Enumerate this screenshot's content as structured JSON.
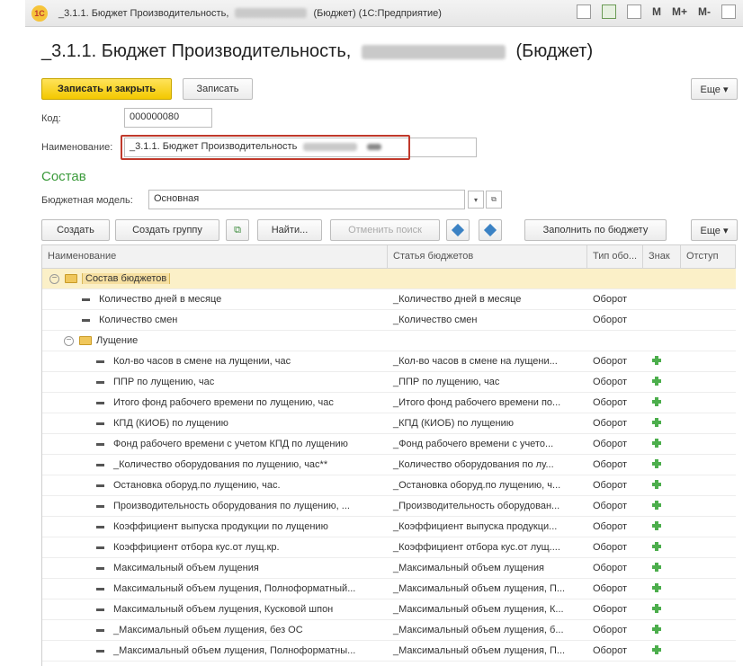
{
  "window": {
    "title": "_3.1.1. Бюджет Производительность,",
    "title_suffix": "(Бюджет) (1С:Предприятие)",
    "buttons": {
      "m": "M",
      "mplus": "M+",
      "mminus": "M-"
    }
  },
  "form": {
    "title": "_3.1.1. Бюджет Производительность,",
    "title_suffix": "(Бюджет)",
    "save_close": "Записать и закрыть",
    "save": "Записать",
    "more": "Еще ▾",
    "code_label": "Код:",
    "code_value": "000000080",
    "name_label": "Наименование:",
    "name_value": "_3.1.1. Бюджет Производительность"
  },
  "composition": {
    "title": "Состав",
    "model_label": "Бюджетная модель:",
    "model_value": "Основная",
    "toolbar": {
      "create": "Создать",
      "create_group": "Создать группу",
      "find": "Найти...",
      "cancel_search": "Отменить поиск",
      "fill_by_budget": "Заполнить по бюджету",
      "more": "Еще ▾"
    },
    "columns": [
      "Наименование",
      "Статья бюджетов",
      "Тип обо...",
      "Знак",
      "Отступ"
    ],
    "rows": [
      {
        "level": 0,
        "kind": "group",
        "name": "Состав бюджетов",
        "article": "",
        "type": "",
        "sign": false,
        "selected": true
      },
      {
        "level": 1,
        "kind": "item",
        "name": "Количество дней в месяце",
        "article": "_Количество дней в месяце",
        "type": "Оборот",
        "sign": false
      },
      {
        "level": 1,
        "kind": "item",
        "name": "Количество смен",
        "article": "_Количество смен",
        "type": "Оборот",
        "sign": false
      },
      {
        "level": 1,
        "kind": "group",
        "name": "Лущение",
        "article": "",
        "type": "",
        "sign": false
      },
      {
        "level": 2,
        "kind": "item",
        "name": "Кол-во часов в смене на лущении, час",
        "article": "_Кол-во часов в смене на лущени...",
        "type": "Оборот",
        "sign": true
      },
      {
        "level": 2,
        "kind": "item",
        "name": "ППР по лущению, час",
        "article": "_ППР по лущению, час",
        "type": "Оборот",
        "sign": true
      },
      {
        "level": 2,
        "kind": "item",
        "name": "Итого фонд рабочего времени по лущению, час",
        "article": "_Итого фонд рабочего времени по...",
        "type": "Оборот",
        "sign": true
      },
      {
        "level": 2,
        "kind": "item",
        "name": "КПД (КИОБ) по лущению",
        "article": "_КПД (КИОБ) по лущению",
        "type": "Оборот",
        "sign": true
      },
      {
        "level": 2,
        "kind": "item",
        "name": "Фонд рабочего времени  с учетом КПД по лущению",
        "article": "_Фонд рабочего времени  с учето...",
        "type": "Оборот",
        "sign": true
      },
      {
        "level": 2,
        "kind": "item",
        "name": "_Количество оборудования по лущению, час**",
        "article": "_Количество оборудования по лу...",
        "type": "Оборот",
        "sign": true
      },
      {
        "level": 2,
        "kind": "item",
        "name": "Остановка оборуд.по лущению, час.",
        "article": "_Остановка оборуд.по лущению, ч...",
        "type": "Оборот",
        "sign": true
      },
      {
        "level": 2,
        "kind": "item",
        "name": "Производительность оборудования по лущению, ...",
        "article": "_Производительность оборудован...",
        "type": "Оборот",
        "sign": true
      },
      {
        "level": 2,
        "kind": "item",
        "name": "Коэффициент выпуска продукции по лущению",
        "article": "_Коэффициент выпуска продукци...",
        "type": "Оборот",
        "sign": true
      },
      {
        "level": 2,
        "kind": "item",
        "name": "Коэффициент  отбора кус.от лущ.кр.",
        "article": "_Коэффициент отбора кус.от лущ....",
        "type": "Оборот",
        "sign": true
      },
      {
        "level": 2,
        "kind": "item",
        "name": "Максимальный объем лущения",
        "article": "_Максимальный объем лущения",
        "type": "Оборот",
        "sign": true
      },
      {
        "level": 2,
        "kind": "item",
        "name": "Максимальный объем лущения, Полноформатный...",
        "article": "_Максимальный объем лущения, П...",
        "type": "Оборот",
        "sign": true
      },
      {
        "level": 2,
        "kind": "item",
        "name": "Максимальный объем лущения, Кусковой шпон",
        "article": "_Максимальный объем лущения, К...",
        "type": "Оборот",
        "sign": true
      },
      {
        "level": 2,
        "kind": "item",
        "name": "_Максимальный объем лущения, без ОС",
        "article": "_Максимальный объем лущения, б...",
        "type": "Оборот",
        "sign": true
      },
      {
        "level": 2,
        "kind": "item",
        "name": "_Максимальный объем лущения, Полноформатны...",
        "article": "_Максимальный объем лущения, П...",
        "type": "Оборот",
        "sign": true
      }
    ]
  }
}
